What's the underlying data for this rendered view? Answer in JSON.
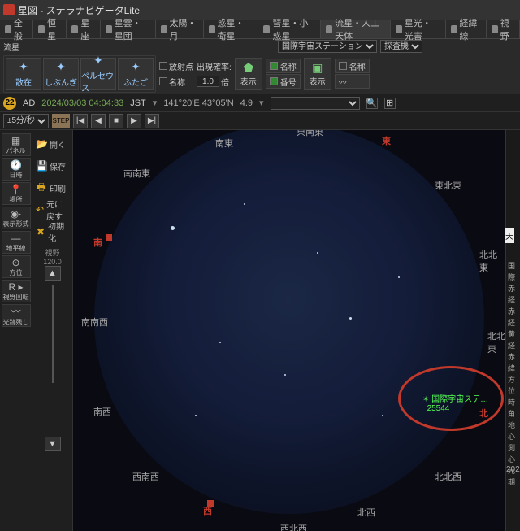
{
  "title": "星図 - ステラナビゲータLite",
  "menu": [
    "全般",
    "恒星",
    "星座",
    "星雲・星団",
    "太陽・月",
    "惑星・衛星",
    "彗星・小惑星",
    "流星・人工天体",
    "星光・光害",
    "経緯線",
    "視野"
  ],
  "meteors": [
    "散在",
    "しぶんぎ",
    "ペルセウス",
    "ふたご"
  ],
  "toolbar": {
    "radiant": "放射点",
    "rate": "出現確率:",
    "rate_val": "1.0",
    "rate_unit": "倍",
    "name_chk": "名称",
    "show": "表示",
    "name2": "名称",
    "number": "番号",
    "show2": "表示",
    "name3": "名称",
    "sat_dd": "国際宇宙ステーション",
    "probe_dd": "探査機"
  },
  "infobar": {
    "badge": "22",
    "era": "AD",
    "date": "2024/03/03 04:04:33",
    "tz": "JST",
    "coords": "141°20'E 43°05'N",
    "mag": "4.9"
  },
  "timebar": {
    "speed": "±5分/秒",
    "step": "STEP"
  },
  "sidebar": [
    "パネル",
    "日時",
    "場所",
    "表示形式",
    "地平線",
    "方位",
    "視野回転",
    "光跡残し"
  ],
  "sidebar_icons": [
    "▦",
    "🕐",
    "📍",
    "◉∙",
    "—",
    "⊙",
    "R ▸",
    "〰"
  ],
  "sidebar2": [
    "開く",
    "保存",
    "印刷",
    "元に戻す",
    "初期化"
  ],
  "sidebar2_fov": "視野\n120.0",
  "directions": {
    "N": "北",
    "NE": "北北東",
    "ENE": "東北東",
    "E": "東",
    "ESE": "東南東",
    "SE": "南東",
    "SSE": "南南東",
    "S": "南",
    "SSW": "南南西",
    "SW": "南西",
    "WSW": "西南西",
    "W": "西",
    "WNW": "西北西",
    "NW": "北西",
    "NNW": "北北西"
  },
  "iss": {
    "name_label": "国際宇宙ステ…",
    "number": "25544"
  },
  "rightpanel": {
    "tab": "天",
    "lines": [
      "国際",
      "赤経",
      "赤経",
      "黄経",
      "赤緯",
      "方位",
      "時角",
      "地心",
      "測心",
      "元期"
    ],
    "year": "202"
  }
}
